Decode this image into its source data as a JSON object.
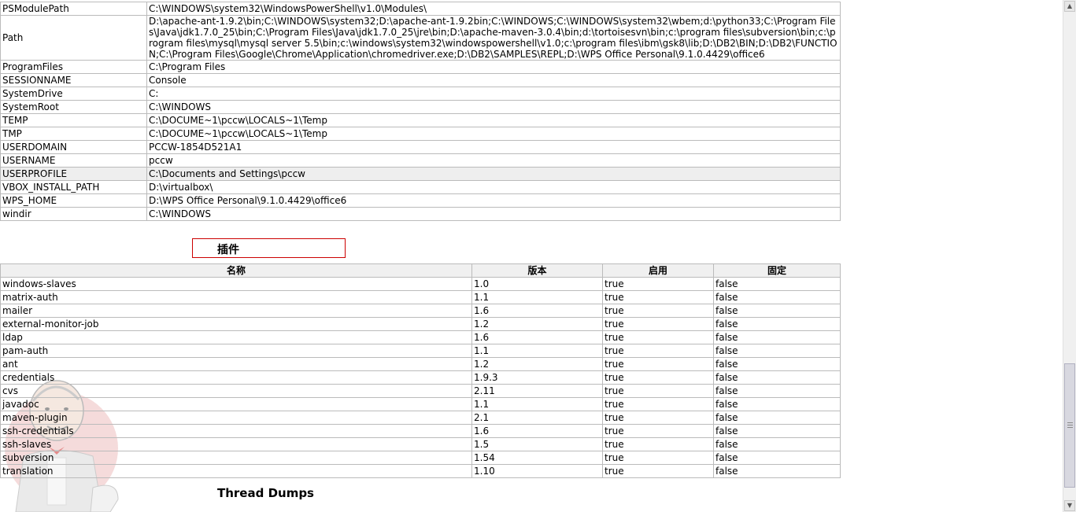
{
  "env_vars": [
    {
      "name": "PSModulePath",
      "value": "C:\\WINDOWS\\system32\\WindowsPowerShell\\v1.0\\Modules\\"
    },
    {
      "name": "Path",
      "value": "D:\\apache-ant-1.9.2\\bin;C:\\WINDOWS\\system32;D:\\apache-ant-1.9.2bin;C:\\WINDOWS;C:\\WINDOWS\\system32\\wbem;d:\\python33;C:\\Program Files\\Java\\jdk1.7.0_25\\bin;C:\\Program Files\\Java\\jdk1.7.0_25\\jre\\bin;D:\\apache-maven-3.0.4\\bin;d:\\tortoisesvn\\bin;c:\\program files\\subversion\\bin;c:\\program files\\mysql\\mysql server 5.5\\bin;c:\\windows\\system32\\windowspowershell\\v1.0;c:\\program files\\ibm\\gsk8\\lib;D:\\DB2\\BIN;D:\\DB2\\FUNCTION;C:\\Program Files\\Google\\Chrome\\Application\\chromedriver.exe;D:\\DB2\\SAMPLES\\REPL;D:\\WPS Office Personal\\9.1.0.4429\\office6"
    },
    {
      "name": "ProgramFiles",
      "value": "C:\\Program Files"
    },
    {
      "name": "SESSIONNAME",
      "value": "Console"
    },
    {
      "name": "SystemDrive",
      "value": "C:"
    },
    {
      "name": "SystemRoot",
      "value": "C:\\WINDOWS"
    },
    {
      "name": "TEMP",
      "value": "C:\\DOCUME~1\\pccw\\LOCALS~1\\Temp"
    },
    {
      "name": "TMP",
      "value": "C:\\DOCUME~1\\pccw\\LOCALS~1\\Temp"
    },
    {
      "name": "USERDOMAIN",
      "value": "PCCW-1854D521A1"
    },
    {
      "name": "USERNAME",
      "value": "pccw"
    },
    {
      "name": "USERPROFILE",
      "value": "C:\\Documents and Settings\\pccw"
    },
    {
      "name": "VBOX_INSTALL_PATH",
      "value": "D:\\virtualbox\\"
    },
    {
      "name": "WPS_HOME",
      "value": "D:\\WPS Office Personal\\9.1.0.4429\\office6"
    },
    {
      "name": "windir",
      "value": "C:\\WINDOWS"
    }
  ],
  "plugins_section": {
    "title": "插件",
    "headers": {
      "name": "名称",
      "version": "版本",
      "enabled": "启用",
      "pinned": "固定"
    },
    "rows": [
      {
        "name": "windows-slaves",
        "version": "1.0",
        "enabled": "true",
        "pinned": "false"
      },
      {
        "name": "matrix-auth",
        "version": "1.1",
        "enabled": "true",
        "pinned": "false"
      },
      {
        "name": "mailer",
        "version": "1.6",
        "enabled": "true",
        "pinned": "false"
      },
      {
        "name": "external-monitor-job",
        "version": "1.2",
        "enabled": "true",
        "pinned": "false"
      },
      {
        "name": "ldap",
        "version": "1.6",
        "enabled": "true",
        "pinned": "false"
      },
      {
        "name": "pam-auth",
        "version": "1.1",
        "enabled": "true",
        "pinned": "false"
      },
      {
        "name": "ant",
        "version": "1.2",
        "enabled": "true",
        "pinned": "false"
      },
      {
        "name": "credentials",
        "version": "1.9.3",
        "enabled": "true",
        "pinned": "false"
      },
      {
        "name": "cvs",
        "version": "2.11",
        "enabled": "true",
        "pinned": "false"
      },
      {
        "name": "javadoc",
        "version": "1.1",
        "enabled": "true",
        "pinned": "false"
      },
      {
        "name": "maven-plugin",
        "version": "2.1",
        "enabled": "true",
        "pinned": "false"
      },
      {
        "name": "ssh-credentials",
        "version": "1.6",
        "enabled": "true",
        "pinned": "false"
      },
      {
        "name": "ssh-slaves",
        "version": "1.5",
        "enabled": "true",
        "pinned": "false"
      },
      {
        "name": "subversion",
        "version": "1.54",
        "enabled": "true",
        "pinned": "false"
      },
      {
        "name": "translation",
        "version": "1.10",
        "enabled": "true",
        "pinned": "false"
      }
    ]
  },
  "thread_dumps": {
    "title": "Thread Dumps"
  },
  "highlighted_env_row": "USERPROFILE",
  "colors": {
    "section_border": "#cc0000",
    "grid_border": "#bbbbbb",
    "highlight_row": "#eeeeee"
  },
  "icons": {
    "mascot": "jenkins-butler-icon",
    "scroll_up": "scroll-up-arrow-icon",
    "scroll_down": "scroll-down-arrow-icon"
  }
}
